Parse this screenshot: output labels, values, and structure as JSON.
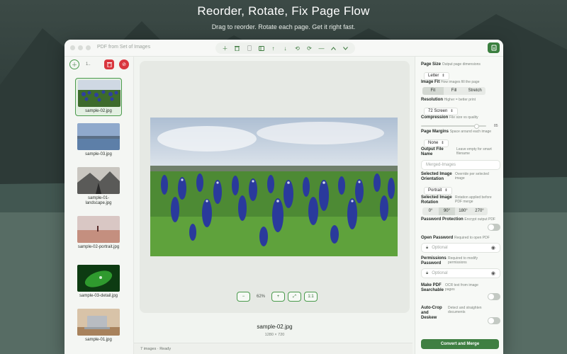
{
  "hero": {
    "headline": "Reorder, Rotate, Fix Page Flow",
    "subline": "Drag to reorder. Rotate each page. Get it right fast."
  },
  "window": {
    "title": "PDF from Set of Images",
    "toolbar_icons": [
      "plus-icon",
      "trash-icon",
      "page-icon",
      "sidebar-icon",
      "arrow-up-icon",
      "arrow-down-icon",
      "rotate-left-icon",
      "rotate-right-icon",
      "minus-icon",
      "chevron-up-icon",
      "chevron-down-icon"
    ]
  },
  "sidebar": {
    "count_label": "1..",
    "items": [
      {
        "caption": "sample-02.jpg",
        "selected": true,
        "kind": "flowers"
      },
      {
        "caption": "sample-03.jpg",
        "selected": false,
        "kind": "lake"
      },
      {
        "caption": "sample-01-landscape.jpg",
        "selected": false,
        "kind": "road"
      },
      {
        "caption": "sample-02-portrait.jpg",
        "selected": false,
        "kind": "desert"
      },
      {
        "caption": "sample-03-detail.jpg",
        "selected": false,
        "kind": "leaf"
      },
      {
        "caption": "sample-01.jpg",
        "selected": false,
        "kind": "laptop"
      }
    ]
  },
  "preview": {
    "zoom_out": "−",
    "zoom_level": "62%",
    "zoom_in": "+",
    "fit": "⤢",
    "actual": "1:1",
    "file_name": "sample-02.jpg",
    "file_dims": "1280 × 720"
  },
  "status": {
    "text": "7 images · Ready"
  },
  "inspector": {
    "page_size": {
      "label": "Page Size",
      "hint": "Output page dimensions",
      "value": "Letter"
    },
    "image_fit": {
      "label": "Image Fit",
      "hint": "How images fill the page",
      "options": [
        "Fit",
        "Fill",
        "Stretch"
      ],
      "selected": "Fit"
    },
    "resolution": {
      "label": "Resolution",
      "hint": "Higher = better print",
      "value": "72 Screen"
    },
    "compression": {
      "label": "Compression",
      "hint": "File size vs quality",
      "value": "85",
      "level": 0.85
    },
    "margins": {
      "label": "Page Margins",
      "hint": "Space around each image",
      "value": "None"
    },
    "filename": {
      "label": "Output File Name",
      "hint": "Leave empty for smart filename",
      "placeholder": "Merged-Images"
    },
    "orientation": {
      "label": "Selected Image Orientation",
      "hint": "Override per selected image",
      "value": "Portrait"
    },
    "rotation": {
      "label": "Selected Image Rotation",
      "hint": "Rotation applied before PDF merge",
      "options": [
        "0°",
        "90°",
        "180°",
        "270°"
      ],
      "selected": "90°"
    },
    "protection": {
      "label": "Password Protection",
      "hint": "Encrypt output PDF"
    },
    "open_pw": {
      "label": "Open Password",
      "hint": "Required to open PDF",
      "placeholder": "Optional"
    },
    "perm_pw": {
      "label": "Permissions Password",
      "hint": "Required to modify permissions",
      "placeholder": "Optional"
    },
    "ocr": {
      "label": "Make PDF Searchable",
      "hint": "OCR text from image pages"
    },
    "autocrop": {
      "label": "Auto-Crop and Deskew",
      "hint": "Detect and straighten documents"
    },
    "merge_button": "Convert and Merge"
  },
  "colors": {
    "accent": "#3f7f42",
    "danger": "#d9363e"
  }
}
